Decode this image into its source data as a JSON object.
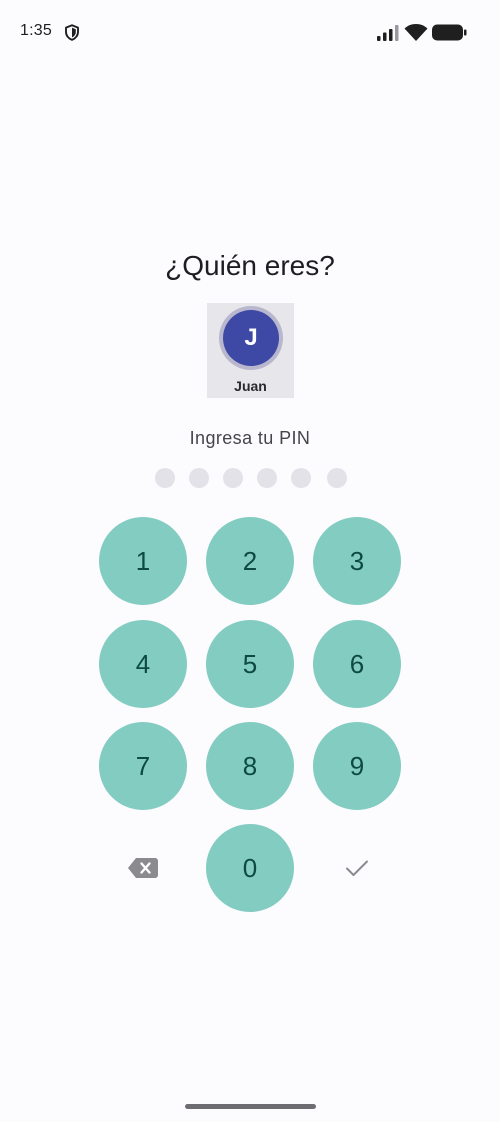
{
  "status_bar": {
    "time": "1:35",
    "icons": [
      "shield-icon",
      "signal-icon",
      "wifi-icon",
      "battery-icon"
    ]
  },
  "screen": {
    "title": "¿Quién eres?",
    "pin_prompt": "Ingresa tu PIN",
    "pin_length": 6,
    "pin_filled": 0
  },
  "profiles": [
    {
      "initial": "J",
      "name": "Juan",
      "color": "#3E49A6",
      "selected": true
    }
  ],
  "keypad": {
    "keys": [
      "1",
      "2",
      "3",
      "4",
      "5",
      "6",
      "7",
      "8",
      "9",
      "0"
    ],
    "delete_icon": "backspace-icon",
    "confirm_icon": "check-icon",
    "key_color": "#82CCC1",
    "key_text_color": "#0E4A43"
  }
}
